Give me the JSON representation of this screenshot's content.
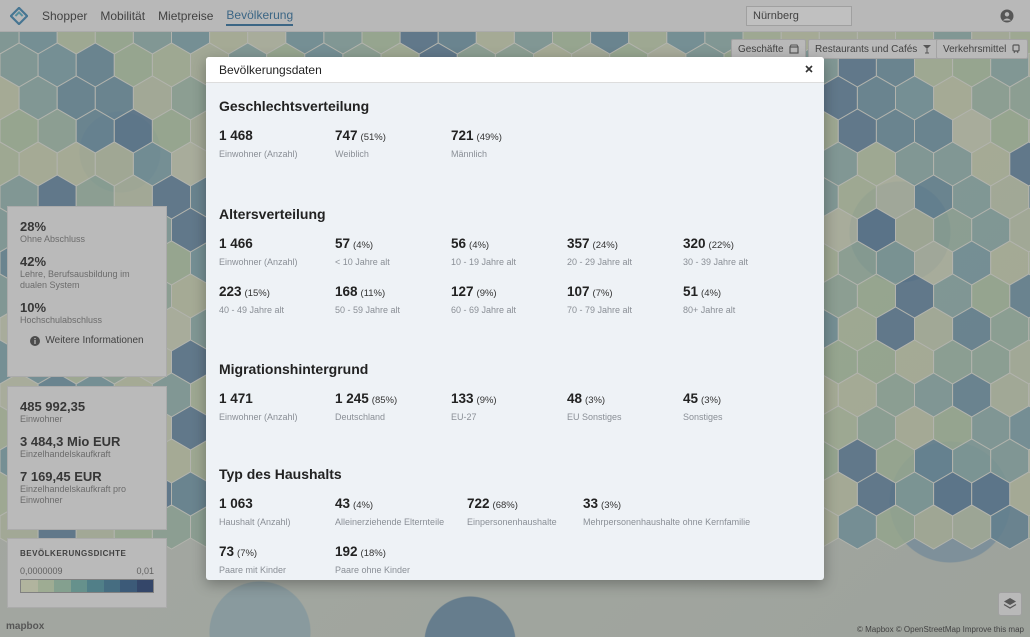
{
  "nav": {
    "items": [
      "Shopper",
      "Mobilität",
      "Mietpreise",
      "Bevölkerung"
    ],
    "active_index": 3
  },
  "search": {
    "value": "Nürnberg"
  },
  "map_buttons": [
    {
      "label": "Geschäfte",
      "icon": "shop-icon"
    },
    {
      "label": "Restaurants und Cafés",
      "icon": "cocktail-icon"
    },
    {
      "label": "Verkehrsmittel",
      "icon": "train-icon"
    }
  ],
  "education": [
    {
      "value": "28%",
      "label": "Ohne Abschluss"
    },
    {
      "value": "42%",
      "label": "Lehre, Berufsausbildung im dualen System"
    },
    {
      "value": "10%",
      "label": "Hochschulabschluss"
    }
  ],
  "more_info": "Weitere Informationen",
  "stats": [
    {
      "value": "485 992,35",
      "label": "Einwohner"
    },
    {
      "value": "3 484,3 Mio EUR",
      "label": "Einzelhandelskaufkraft"
    },
    {
      "value": "7 169,45 EUR",
      "label": "Einzelhandelskaufkraft pro Einwohner"
    }
  ],
  "density": {
    "title": "BEVÖLKERUNGSDICHTE",
    "min": "0,0000009",
    "max": "0,01",
    "colors": [
      "#e7ecc8",
      "#c8dfb6",
      "#9fcbb0",
      "#6fb3ab",
      "#4c97a5",
      "#3a7a9a",
      "#2b5b8c",
      "#1d3a73"
    ]
  },
  "attribution": "© Mapbox © OpenStreetMap Improve this map",
  "mapbox_logo": "mapbox",
  "modal": {
    "title": "Bevölkerungsdaten",
    "sections": [
      {
        "title": "Geschlechtsverteilung",
        "rows": [
          [
            {
              "num": "1 468",
              "pct": "",
              "label": "Einwohner (Anzahl)"
            },
            {
              "num": "747",
              "pct": "(51%)",
              "label": "Weiblich"
            },
            {
              "num": "721",
              "pct": "(49%)",
              "label": "Männlich"
            }
          ]
        ]
      },
      {
        "title": "Altersverteilung",
        "rows": [
          [
            {
              "num": "1 466",
              "pct": "",
              "label": "Einwohner (Anzahl)"
            },
            {
              "num": "57",
              "pct": "(4%)",
              "label": "< 10 Jahre alt"
            },
            {
              "num": "56",
              "pct": "(4%)",
              "label": "10 - 19 Jahre alt"
            },
            {
              "num": "357",
              "pct": "(24%)",
              "label": "20 - 29 Jahre alt"
            },
            {
              "num": "320",
              "pct": "(22%)",
              "label": "30 - 39 Jahre alt"
            }
          ],
          [
            {
              "num": "223",
              "pct": "(15%)",
              "label": "40 - 49 Jahre alt"
            },
            {
              "num": "168",
              "pct": "(11%)",
              "label": "50 - 59 Jahre alt"
            },
            {
              "num": "127",
              "pct": "(9%)",
              "label": "60 - 69 Jahre alt"
            },
            {
              "num": "107",
              "pct": "(7%)",
              "label": "70 - 79 Jahre alt"
            },
            {
              "num": "51",
              "pct": "(4%)",
              "label": "80+ Jahre alt"
            }
          ]
        ]
      },
      {
        "title": "Migrationshintergrund",
        "rows": [
          [
            {
              "num": "1 471",
              "pct": "",
              "label": "Einwohner (Anzahl)"
            },
            {
              "num": "1 245",
              "pct": "(85%)",
              "label": "Deutschland"
            },
            {
              "num": "133",
              "pct": "(9%)",
              "label": "EU-27"
            },
            {
              "num": "48",
              "pct": "(3%)",
              "label": "EU Sonstiges"
            },
            {
              "num": "45",
              "pct": "(3%)",
              "label": "Sonstiges"
            }
          ]
        ]
      },
      {
        "title": "Typ des Haushalts",
        "rows": [
          [
            {
              "num": "1 063",
              "pct": "",
              "label": "Haushalt (Anzahl)"
            },
            {
              "num": "43",
              "pct": "(4%)",
              "label": "Alleinerziehende Elternteile"
            },
            {
              "num": "722",
              "pct": "(68%)",
              "label": "Einpersonenhaushalte"
            },
            {
              "num": "33",
              "pct": "(3%)",
              "label": "Mehrpersonenhaushalte ohne Kernfamilie"
            }
          ],
          [
            {
              "num": "73",
              "pct": "(7%)",
              "label": "Paare mit Kinder"
            },
            {
              "num": "192",
              "pct": "(18%)",
              "label": "Paare ohne Kinder"
            }
          ]
        ]
      }
    ]
  }
}
